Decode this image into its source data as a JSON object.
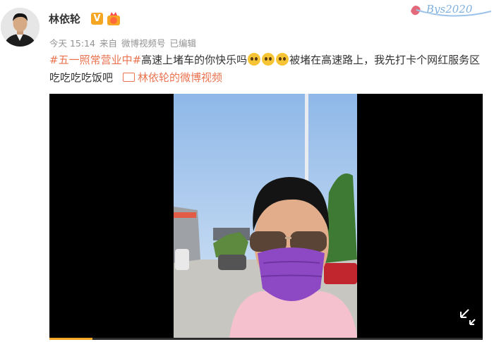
{
  "post": {
    "author": "林依轮",
    "verified_badge": "V",
    "meta": [
      "今天 15:14",
      "来自",
      "微博视频号",
      "已编辑"
    ],
    "hashtag": "#五一照常营业中#",
    "text_part1": "高速上堵车的你快乐吗",
    "text_part2": "被堵在高速路上，我先打卡个网红服务区吃吃吃吃饭吧",
    "video_link": "林依轮的微博视频"
  },
  "watermark": "Bys2020",
  "video": {
    "progress_percent": 10
  },
  "icons": [
    "avatar",
    "verified-icon",
    "medal-icon",
    "crying-emoji-icon",
    "video-link-icon",
    "fullscreen-icon"
  ],
  "colors": {
    "link": "#eb7350",
    "badge": "#f5a623",
    "meta": "#939393",
    "player_bg": "#000000"
  }
}
